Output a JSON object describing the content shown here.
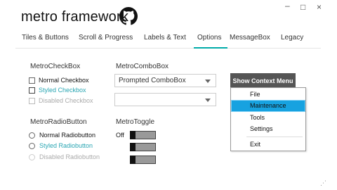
{
  "window": {
    "title": "metro framework",
    "minimize": "–",
    "maximize": "□",
    "close": "×"
  },
  "tabs": [
    {
      "label": "Tiles & Buttons"
    },
    {
      "label": "Scroll & Progress"
    },
    {
      "label": "Labels & Text"
    },
    {
      "label": "Options"
    },
    {
      "label": "MessageBox"
    },
    {
      "label": "Legacy"
    }
  ],
  "active_tab": "Options",
  "checkbox_section": {
    "title": "MetroCheckBox",
    "items": [
      {
        "label": "Normal Checkbox",
        "checked": false,
        "color": "#111111"
      },
      {
        "label": "Styled Checkbox",
        "checked": false,
        "color": "#2aa6b3"
      },
      {
        "label": "Disabled Checkbox",
        "checked": false,
        "color": "#aaaaaa"
      }
    ]
  },
  "radio_section": {
    "title": "MetroRadioButton",
    "items": [
      {
        "label": "Normal Radiobutton",
        "color": "#111111"
      },
      {
        "label": "Styled Radiobutton",
        "color": "#2aa6b3"
      },
      {
        "label": "Disabled Radiobutton",
        "color": "#aaaaaa"
      }
    ]
  },
  "combo_section": {
    "title": "MetroComboBox",
    "combo1_text": "Prompted ComboBox",
    "combo2_text": ""
  },
  "toggle_section": {
    "title": "MetroToggle",
    "toggles": [
      {
        "label": "Off"
      },
      {
        "label": ""
      },
      {
        "label": ""
      }
    ]
  },
  "context_button": {
    "label": "Show Context Menu"
  },
  "context_menu": {
    "items": [
      {
        "label": "File"
      },
      {
        "label": "Maintenance"
      },
      {
        "label": "Tools"
      },
      {
        "label": "Settings"
      },
      {
        "label": "Exit"
      }
    ],
    "selected": "Maintenance"
  },
  "colors": {
    "accent": "#00aba9",
    "styled_text": "#2aa6b3",
    "menu_highlight": "#17a2e0"
  },
  "icons": {
    "title_icon": "github-icon",
    "resize": "resize-grip-icon"
  },
  "grip": "⋰"
}
